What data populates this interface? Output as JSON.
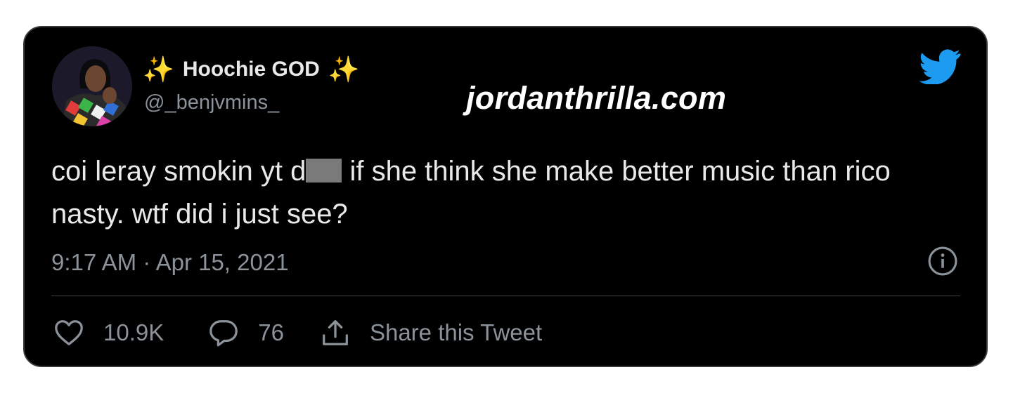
{
  "author": {
    "display_name": "Hoochie GOD",
    "name_prefix_emoji": "✨",
    "name_suffix_emoji": "✨",
    "handle": "@_benjvmins_"
  },
  "watermark": "jordanthrilla.com",
  "tweet": {
    "text_before_redaction": "coi leray smokin yt d",
    "text_after_redaction": " if she think she make better music than rico nasty. wtf did i just see?",
    "timestamp": "9:17 AM · Apr 15, 2021"
  },
  "actions": {
    "likes": "10.9K",
    "replies": "76",
    "share_label": "Share this Tweet"
  },
  "icons": {
    "brand": "twitter-bird-icon",
    "info": "info-icon",
    "like": "heart-icon",
    "reply": "reply-bubble-icon",
    "share": "share-icon"
  },
  "colors": {
    "background": "#000000",
    "primary_text": "#e7e9ea",
    "secondary_text": "#8b9299",
    "twitter_blue": "#1d9bf0",
    "sparkle": "#f7c948"
  }
}
